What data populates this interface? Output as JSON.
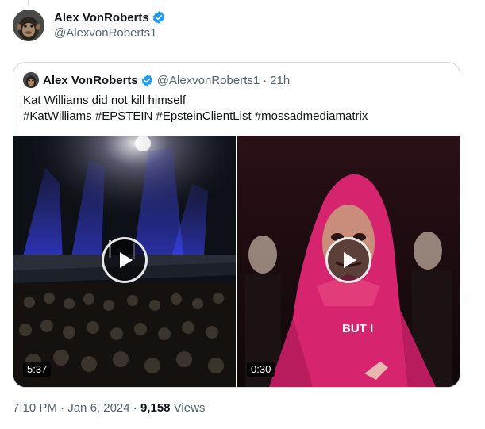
{
  "author": {
    "name": "Alex VonRoberts",
    "handle": "@AlexvonRoberts1",
    "avatar_icon": "chimpanzee-avatar",
    "verified_icon": "verified-badge-icon"
  },
  "quoted_tweet": {
    "name": "Alex VonRoberts",
    "handle": "@AlexvonRoberts1",
    "separator": "·",
    "time": "21h",
    "text_line1": "Kat Williams did not kill himself",
    "text_line2": "#KatWilliams #EPSTEIN #EpsteinClientList #mossadmediamatrix",
    "videos": [
      {
        "duration": "5:37",
        "icon": "play-icon",
        "scene": "stage-with-audience"
      },
      {
        "duration": "0:30",
        "icon": "play-icon",
        "scene": "masked-figure-red-hood",
        "caption": "BUT I"
      }
    ]
  },
  "footer": {
    "time": "7:10 PM",
    "sep1": "·",
    "date": "Jan 6, 2024",
    "sep2": "·",
    "views_count": "9,158",
    "views_label": "Views"
  },
  "colors": {
    "verified_blue": "#1d9bf0",
    "text_primary": "#0f1419",
    "text_secondary": "#536471",
    "border": "#cfd9de",
    "hood_pink": "#d6246e"
  }
}
